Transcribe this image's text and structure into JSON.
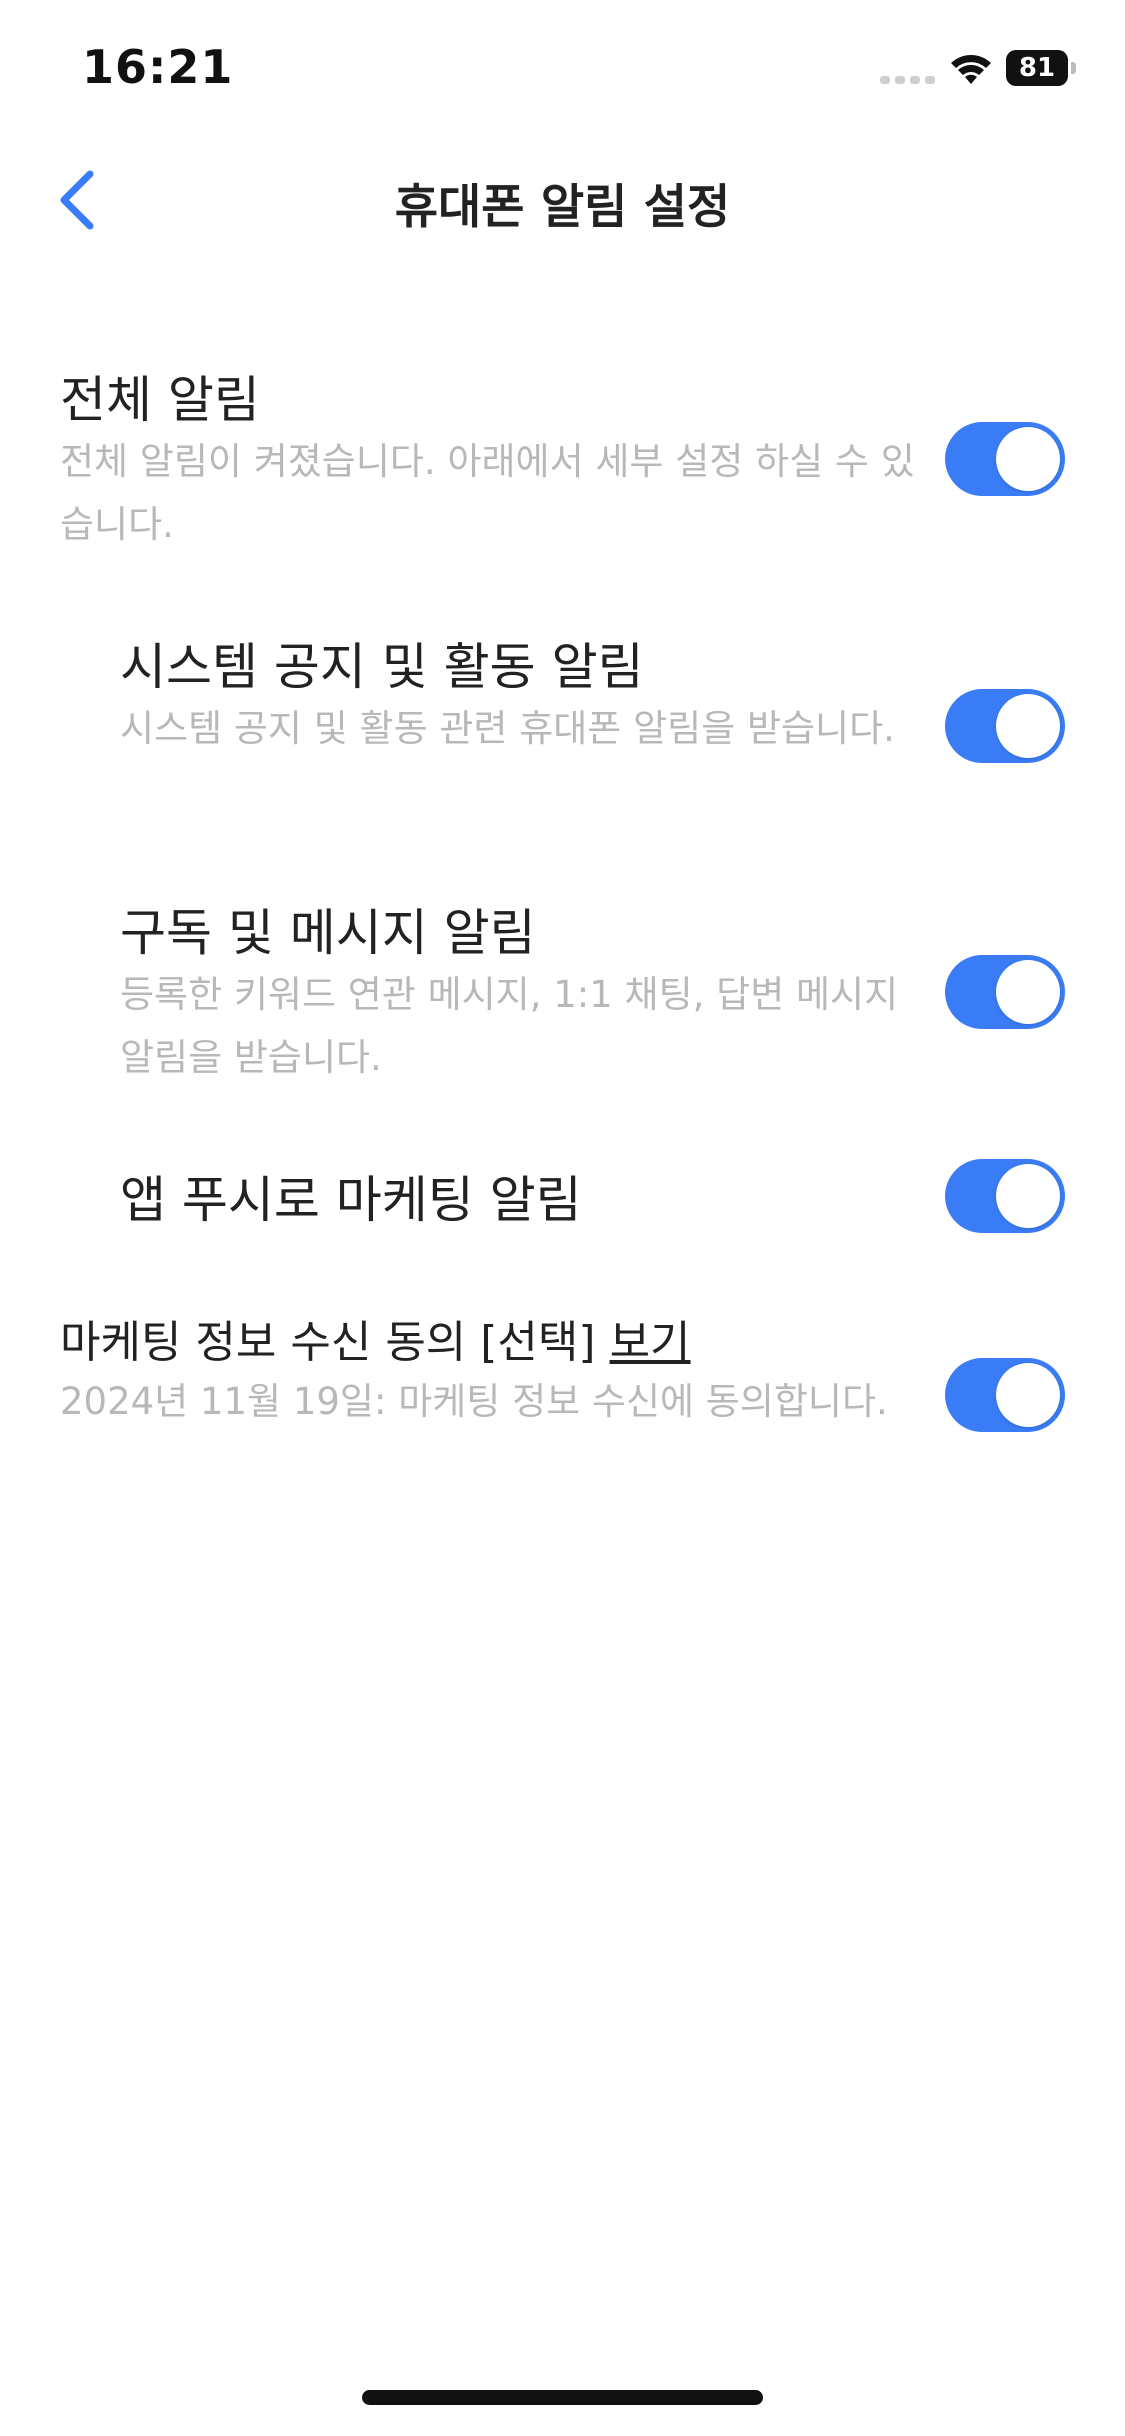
{
  "status_bar": {
    "time": "16:21",
    "battery": "81",
    "icons": [
      "cell-signal-icon",
      "wifi-icon",
      "battery-icon"
    ]
  },
  "nav": {
    "title": "휴대폰 알림 설정",
    "back_icon": "chevron-left-icon"
  },
  "colors": {
    "accent": "#3a7cf5",
    "title_text": "#222222",
    "description_text": "#b8b8b8"
  },
  "settings": {
    "all": {
      "title": "전체 알림",
      "description": "전체 알림이 켜졌습니다. 아래에서 세부 설정 하실 수 있습니다.",
      "enabled": true
    },
    "system": {
      "title": "시스템 공지 및 활동 알림",
      "description": "시스템 공지 및 활동 관련 휴대폰 알림을 받습니다.",
      "enabled": true
    },
    "subscription": {
      "title": "구독 및 메시지 알림",
      "description": "등록한 키워드 연관 메시지, 1:1 채팅, 답변 메시지 알림을 받습니다.",
      "enabled": true
    },
    "marketing_push": {
      "title": "앱 푸시로 마케팅 알림",
      "enabled": true
    },
    "marketing_consent": {
      "title": "마케팅 정보 수신 동의 [선택]",
      "link": "보기",
      "description": "2024년 11월 19일: 마케팅 정보 수신에 동의합니다.",
      "enabled": true
    }
  }
}
